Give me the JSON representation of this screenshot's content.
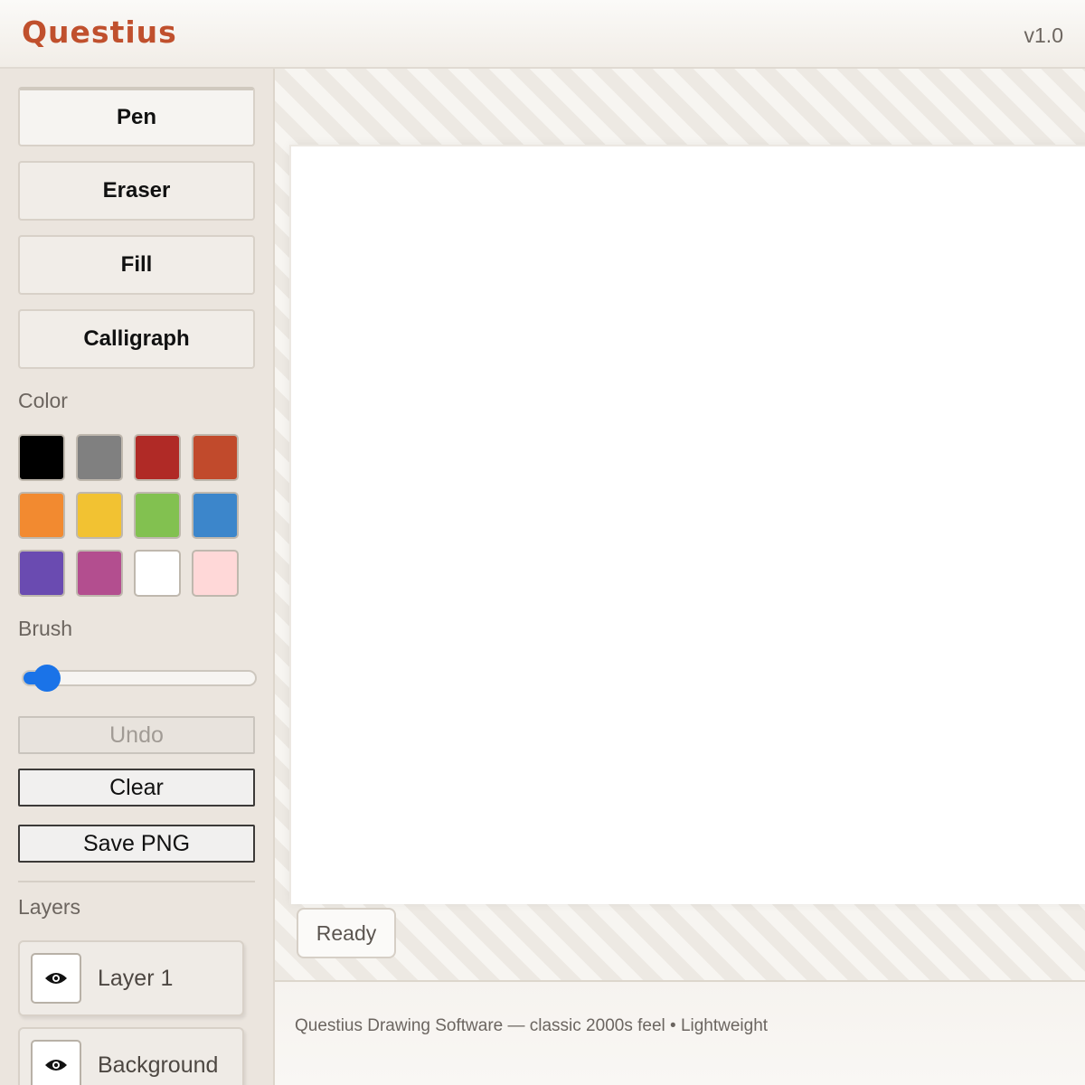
{
  "header": {
    "title": "Questius",
    "version": "v1.0"
  },
  "sidebar": {
    "tools": [
      "Pen",
      "Eraser",
      "Fill",
      "Calligraph"
    ],
    "active_tool": "Pen",
    "color_label": "Color",
    "colors": [
      "#000000",
      "#808080",
      "#b02a26",
      "#c14a2c",
      "#f28a30",
      "#f2c232",
      "#82c150",
      "#3c86cb",
      "#6a4bb1",
      "#b34e8f",
      "#ffffff",
      "#ffd8d8"
    ],
    "brush_label": "Brush",
    "brush_level": 0.1,
    "undo_label": "Undo",
    "clear_label": "Clear",
    "save_label": "Save PNG",
    "layers_label": "Layers",
    "layers": [
      "Layer 1",
      "Background"
    ]
  },
  "canvas": {
    "status": "Ready"
  },
  "footer": {
    "text": "Questius Drawing Software — classic 2000s feel • Lightweight"
  }
}
